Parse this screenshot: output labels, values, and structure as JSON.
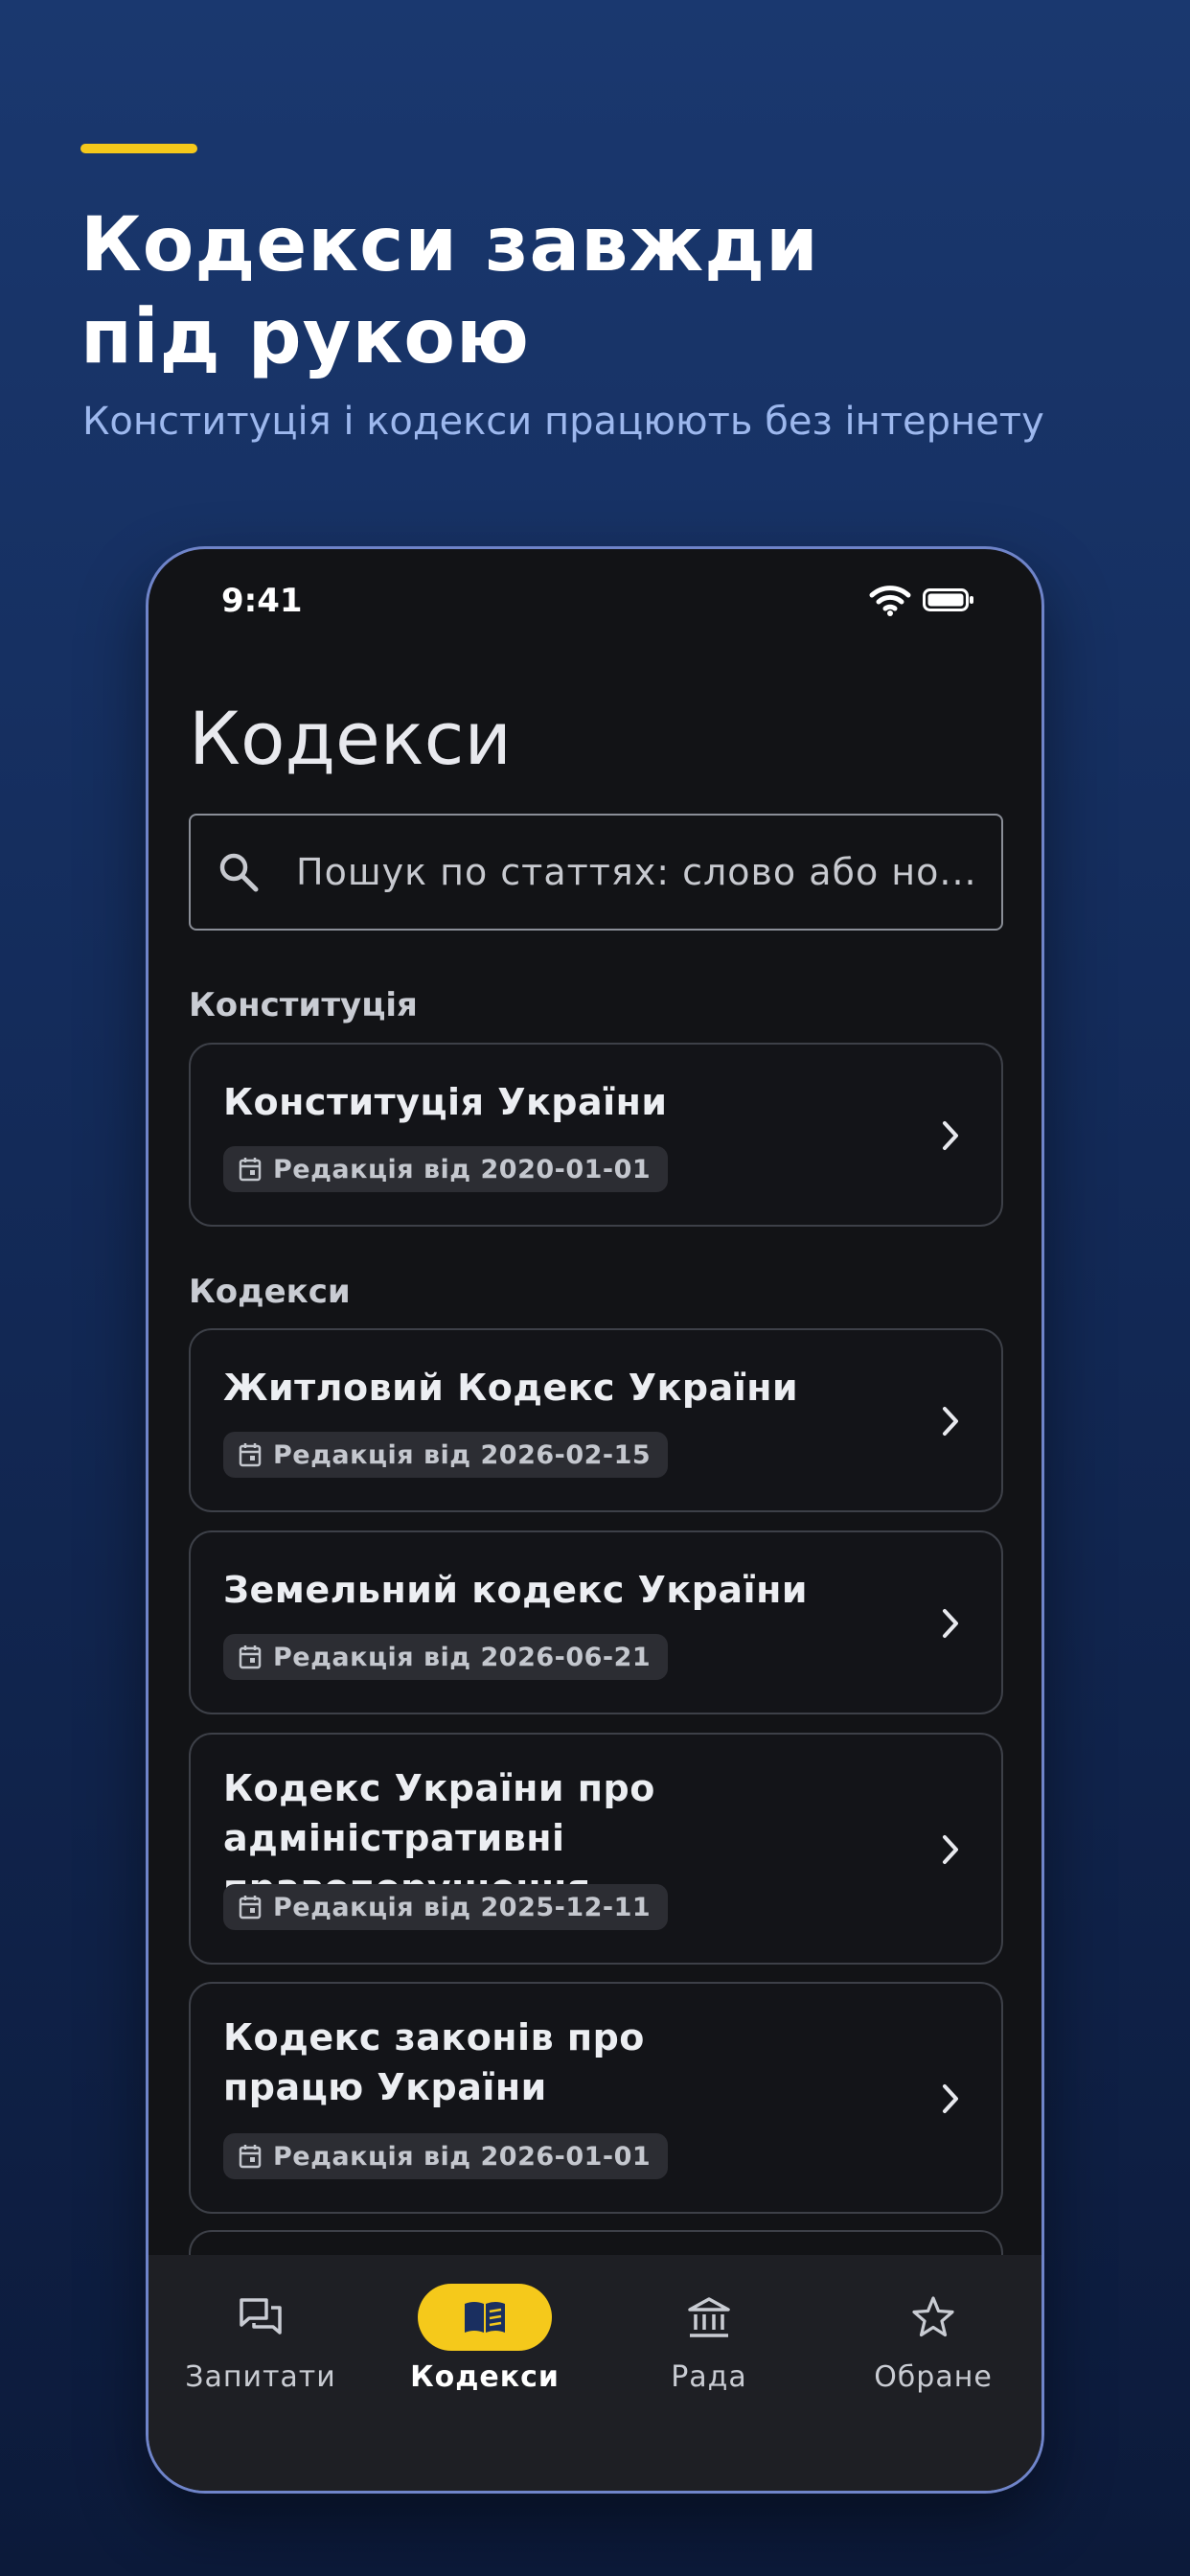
{
  "promo": {
    "headline_line1": "Кодекси завжди",
    "headline_line2": "під рукою",
    "subtitle": "Конституція і кодекси працюють без інтернету"
  },
  "status_bar": {
    "time": "9:41"
  },
  "screen": {
    "title": "Кодекси",
    "search_placeholder": "Пошук по статтях: слово або но..."
  },
  "sections": [
    {
      "label": "Конституція",
      "items": [
        {
          "title": "Конституція України",
          "badge": "Редакція від 2020-01-01"
        }
      ]
    },
    {
      "label": "Кодекси",
      "items": [
        {
          "title": "Житловий Кодекс України",
          "badge": "Редакція від 2026-02-15"
        },
        {
          "title": "Земельний кодекс України",
          "badge": "Редакція від 2026-06-21"
        },
        {
          "title": "Кодекс України про адміністративні правопорушення",
          "badge": "Редакція від 2025-12-11"
        },
        {
          "title": "Кодекс законів про працю України",
          "badge": "Редакція від 2026-01-01"
        }
      ]
    }
  ],
  "bottom_nav": [
    {
      "label": "Запитати",
      "icon": "chat-icon",
      "active": false
    },
    {
      "label": "Кодекси",
      "icon": "book-icon",
      "active": true
    },
    {
      "label": "Рада",
      "icon": "institution-icon",
      "active": false
    },
    {
      "label": "Обране",
      "icon": "star-icon",
      "active": false
    }
  ],
  "colors": {
    "accent": "#f5c91b",
    "background_top": "#1a386f",
    "background_bottom": "#0c1a3a",
    "screen_bg": "#121316",
    "subtitle": "#9db8ee"
  }
}
